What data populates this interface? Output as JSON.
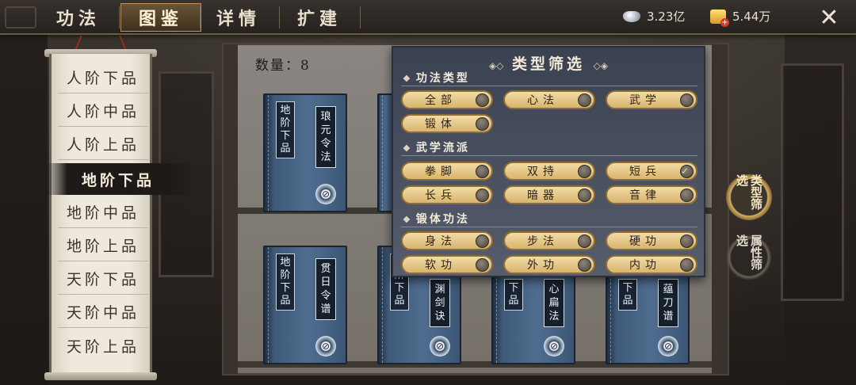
{
  "topbar": {
    "tabs": [
      "功法",
      "图鉴",
      "详情",
      "扩建"
    ],
    "active_tab": "图鉴",
    "silver_amount": "3.23亿",
    "gold_amount": "5.44万",
    "close_icon": "close-icon"
  },
  "sidebar": {
    "ranks": [
      "人阶下品",
      "人阶中品",
      "人阶上品",
      "地阶下品",
      "地阶中品",
      "地阶上品",
      "天阶下品",
      "天阶中品",
      "天阶上品"
    ],
    "active_rank": "地阶下品"
  },
  "main": {
    "count_label": "数量：8",
    "books": [
      {
        "rank": "地阶下品",
        "title": "琅元令法"
      },
      {
        "rank": "地阶下品",
        "title": "贯日令谱"
      },
      {
        "rank": "地阶下品",
        "title": "渊剑诀"
      },
      {
        "rank": "下品",
        "title": "心扁法"
      },
      {
        "rank": "下品",
        "title": "蕴刀谱"
      }
    ]
  },
  "filter_popup": {
    "title": "类型筛选",
    "sections": [
      {
        "title": "功法类型",
        "options": [
          "全部",
          "心法",
          "武学",
          "锻体"
        ]
      },
      {
        "title": "武学流派",
        "options": [
          "拳脚",
          "双持",
          "短兵",
          "长兵",
          "暗器",
          "音律"
        ]
      },
      {
        "title": "锻体功法",
        "options": [
          "身法",
          "步法",
          "硬功",
          "软功",
          "外功",
          "内功"
        ]
      }
    ],
    "checked_option": "短兵"
  },
  "side_buttons": {
    "type_filter": "类型筛选",
    "attr_filter": "属性筛选"
  },
  "colors": {
    "accent_gold": "#d8b46f",
    "book_blue": "#4f6d8f",
    "popup_bg": "#4b5262"
  }
}
